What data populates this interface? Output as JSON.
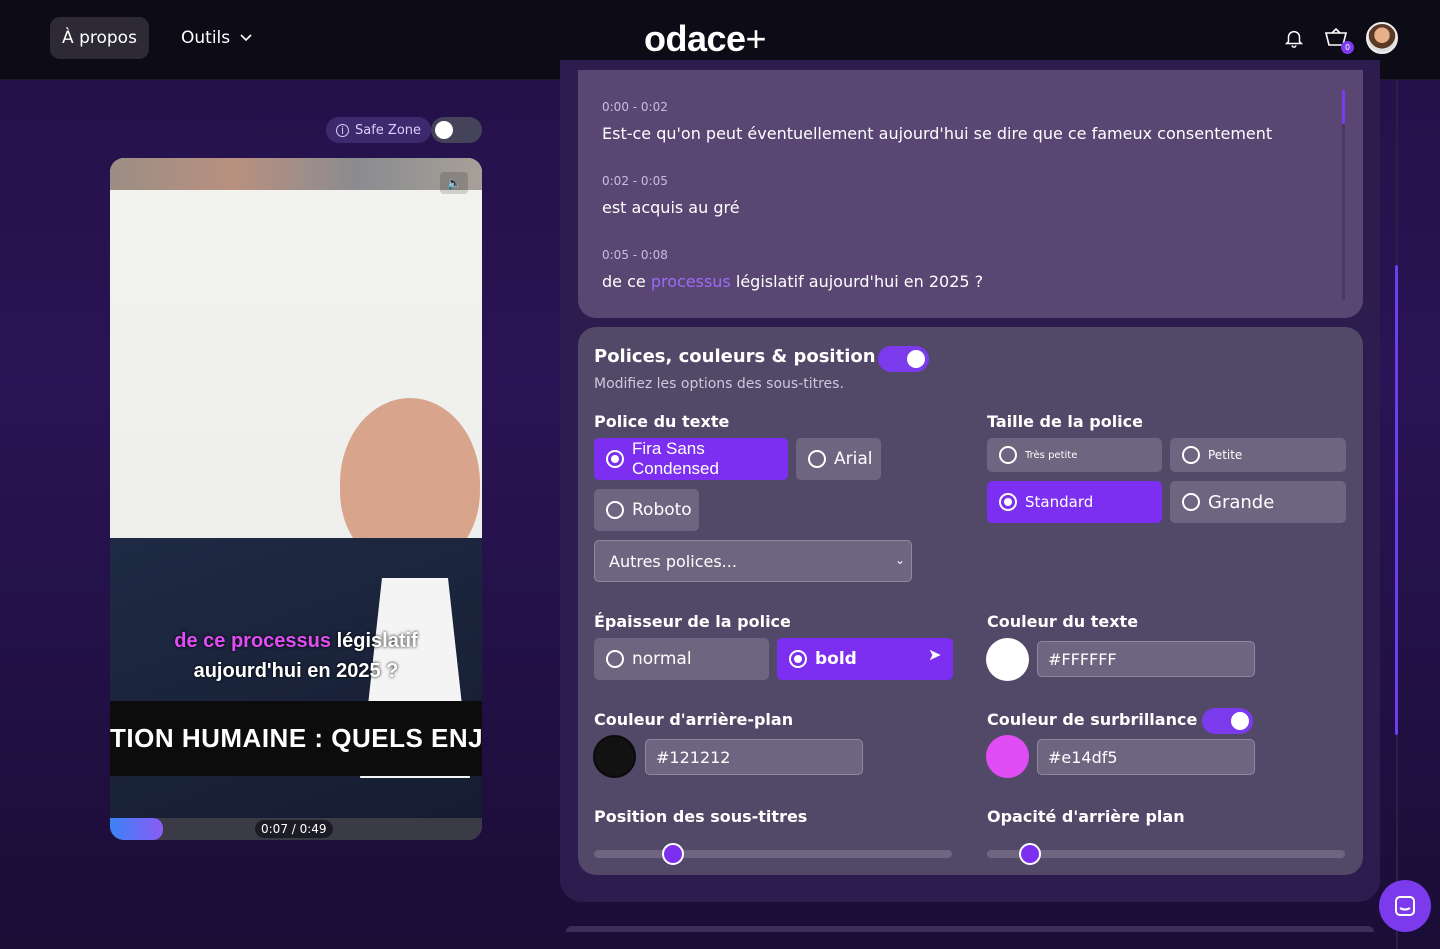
{
  "topbar": {
    "about_label": "À propos",
    "tools_label": "Outils",
    "logo": "odace",
    "logo_plus": "+",
    "cart_count": "0"
  },
  "preview": {
    "safe_zone_label": "Safe Zone",
    "safe_zone_enabled": false,
    "subtitle_line1_highlight": "de ce processus",
    "subtitle_line1_rest": " législatif",
    "subtitle_line2": "aujourd'hui en 2025 ?",
    "banner_text": "TION HUMAINE : QUELS ENJEUX AU",
    "time": "0:07 / 0:49",
    "progress_fraction": 0.143
  },
  "transcript": [
    {
      "time": "0:00 - 0:02",
      "text": "Est-ce qu'on peut éventuellement aujourd'hui se dire que ce fameux consentement"
    },
    {
      "time": "0:02 - 0:05",
      "text": "est acquis au gré"
    },
    {
      "time": "0:05 - 0:08",
      "text_before": "de ce ",
      "keyword": "processus",
      "text_after": " législatif aujourd'hui en 2025 ?"
    }
  ],
  "settings": {
    "title": "Polices, couleurs & position",
    "subtitle": "Modifiez les options des sous-titres.",
    "enabled": true,
    "font_label": "Police du texte",
    "fonts": [
      "Fira Sans Condensed",
      "Arial",
      "Roboto"
    ],
    "font_selected": "Fira Sans Condensed",
    "other_fonts": "Autres polices...",
    "size_label": "Taille de la police",
    "sizes": [
      "Très petite",
      "Petite",
      "Standard",
      "Grande"
    ],
    "size_selected": "Standard",
    "weight_label": "Épaisseur de la police",
    "weights": [
      "normal",
      "bold"
    ],
    "weight_selected": "bold",
    "text_color_label": "Couleur du texte",
    "text_color": "#FFFFFF",
    "bg_color_label": "Couleur d'arrière-plan",
    "bg_color": "#121212",
    "highlight_color_label": "Couleur de surbrillance",
    "highlight_color": "#e14df5",
    "highlight_enabled": true,
    "position_label": "Position des sous-titres",
    "position_value": 0.22,
    "opacity_label": "Opacité d'arrière plan",
    "opacity_value": 0.12
  },
  "colors": {
    "accent": "#7c2ff0",
    "highlight": "#e14df5"
  }
}
